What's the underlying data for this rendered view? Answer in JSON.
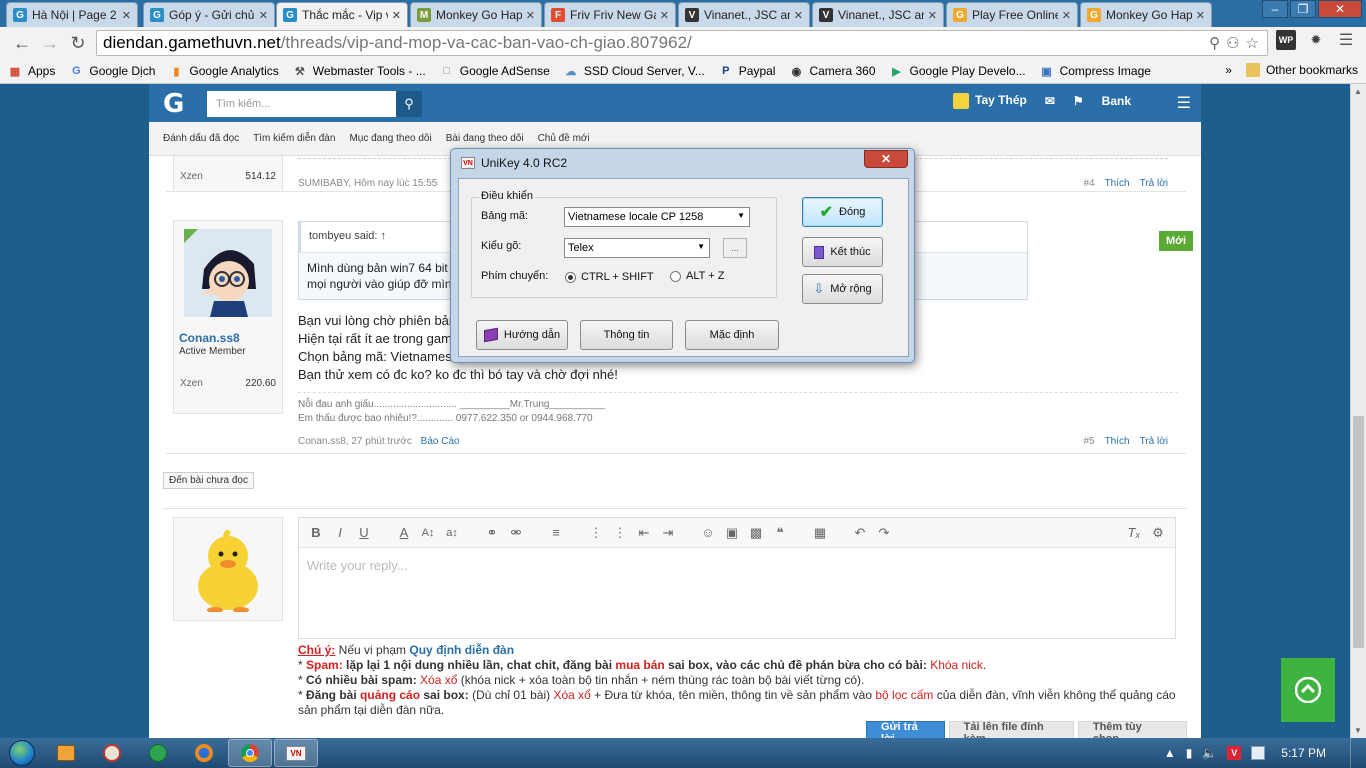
{
  "browser": {
    "tabs": [
      {
        "title": "Hà Nội | Page 2",
        "favicon": "G",
        "color": "#2a8ec9",
        "active": false
      },
      {
        "title": "Góp ý - Gửi chủ đề",
        "favicon": "G",
        "color": "#2a8ec9",
        "active": false
      },
      {
        "title": "Thắc mắc - Vip và mọp",
        "favicon": "G",
        "color": "#2a8ec9",
        "active": true
      },
      {
        "title": "Monkey Go Happy",
        "favicon": "M",
        "color": "#7a9b3c",
        "active": false
      },
      {
        "title": "Friv Friv New Games",
        "favicon": "F",
        "color": "#e14b2f",
        "active": false
      },
      {
        "title": "Vinanet., JSC and",
        "favicon": "V",
        "color": "#333333",
        "active": false
      },
      {
        "title": "Vinanet., JSC and",
        "favicon": "V",
        "color": "#333333",
        "active": false
      },
      {
        "title": "Play Free Online",
        "favicon": "G",
        "color": "#f0a92c",
        "active": false
      },
      {
        "title": "Monkey Go Happy",
        "favicon": "G",
        "color": "#f0a92c",
        "active": false
      }
    ],
    "url_host": "diendan.gamethuvn.net",
    "url_path": "/threads/vip-and-mop-va-cac-ban-vao-ch-giao.807962/",
    "bookmarks": [
      {
        "label": "Apps",
        "icon": "apps-icon"
      },
      {
        "label": "Google Dịch",
        "icon": "translate-icon"
      },
      {
        "label": "Google Analytics",
        "icon": "analytics-icon"
      },
      {
        "label": "Webmaster Tools - ...",
        "icon": "webmaster-icon"
      },
      {
        "label": "Google AdSense",
        "icon": "page-icon"
      },
      {
        "label": "SSD Cloud Server, V...",
        "icon": "cloud-icon"
      },
      {
        "label": "Paypal",
        "icon": "paypal-icon"
      },
      {
        "label": "Camera 360",
        "icon": "camera-icon"
      },
      {
        "label": "Google Play Develo...",
        "icon": "play-icon"
      },
      {
        "label": "Compress Image",
        "icon": "image-icon"
      }
    ],
    "bookmarks_more": "»",
    "other_bookmarks": "Other bookmarks"
  },
  "forum": {
    "logo": "G",
    "search_placeholder": "Tìm kiếm...",
    "username": "Tay Thép",
    "bank": "Bank",
    "subnav": [
      "Đánh dấu đã đọc",
      "Tìm kiếm diễn đàn",
      "Mục đang theo dõi",
      "Bài đang theo dõi",
      "Chủ đề mới"
    ],
    "post4": {
      "xzen_label": "Xzen",
      "xzen_value": "514.12",
      "meta": "SUMIBABY, Hôm nay lúc 15:55",
      "num": "#4",
      "like": "Thích",
      "reply": "Trả lời"
    },
    "post5": {
      "username": "Conan.ss8",
      "role": "Active Member",
      "xzen_label": "Xzen",
      "xzen_value": "220.60",
      "quote_author": "tombyeu said: ↑",
      "quote_line1": "Mình dùng bản win7 64 bit",
      "quote_line2": "mọi người vào giúp đỡ mình",
      "body": [
        "Bạn vui lòng chờ phiên bản",
        "Hiện tại rất ít ae trong gam",
        "Chọn bảng mã: Vietnames",
        "Bạn thử xem có đc ko? ko đc thì bó tay và chờ đợi nhé!"
      ],
      "sig_line1": "Nỗi đau anh giấu.............................. _________Mr.Trung__________",
      "sig_line2": "Em thấu được bao nhiêu!?............. 0977.622.350 or 0944.968.770",
      "meta": "Conan.ss8, 27 phút trước",
      "report": "Báo Cáo",
      "num": "#5",
      "like": "Thích",
      "reply": "Trả lời"
    },
    "new_badge": "Mới",
    "unread_button": "Đến bài chưa đọc",
    "editor_placeholder": "Write your reply...",
    "rules": {
      "note": "Chú ý:",
      "note_text": " Nếu vi phạm ",
      "rules_link": "Quy định diễn đàn",
      "r1_head": "* ",
      "r1_label": "Spam:",
      "r1_text": " lặp lại 1 nội dung nhiều lần, chat chit, đăng bài ",
      "r1_red": "mua bán",
      "r1_text2": " sai box, vào các chủ đề phán bừa cho có bài: ",
      "r1_penalty": "Khóa nick",
      "r1_end": ".",
      "r2_head": "* ",
      "r2_label": "Có nhiều bài spam:",
      "r2_red": " Xóa xổ",
      "r2_text": " (khóa nick + xóa toàn bộ tin nhắn + ném thùng rác toàn bộ bài viết từng có).",
      "r3_head": "* ",
      "r3_label": "Đăng bài ",
      "r3_red": "quảng cáo",
      "r3_label2": " sai box:",
      "r3_text": " (Dù chỉ 01 bài) ",
      "r3_red2": "Xóa xổ",
      "r3_text2": " + Đưa từ khóa, tên miền, thông tin về sản phẩm vào ",
      "r3_red3": "bộ lọc cấm",
      "r3_text3": " của diễn đàn, vĩnh viễn không thể quảng cáo sản phẩm tại diễn đàn nữa."
    },
    "buttons": {
      "send": "Gửi trả lời",
      "upload": "Tải lên file đính kèm",
      "more": "Thêm tùy chọn..."
    }
  },
  "unikey": {
    "title": "UniKey 4.0 RC2",
    "group_title": "Điều khiển",
    "charset_label": "Bảng mã:",
    "charset_value": "Vietnamese locale CP 1258",
    "input_label": "Kiểu gõ:",
    "input_value": "Telex",
    "dots": "...",
    "switch_label": "Phím chuyển:",
    "switch_opt1": "CTRL + SHIFT",
    "switch_opt2": "ALT + Z",
    "btn_close": "Đóng",
    "btn_exit": "Kết thúc",
    "btn_expand": "Mở rộng",
    "btn_help": "Hướng dẫn",
    "btn_info": "Thông tin",
    "btn_default": "Mặc định"
  },
  "taskbar": {
    "clock": "5:17 PM"
  }
}
